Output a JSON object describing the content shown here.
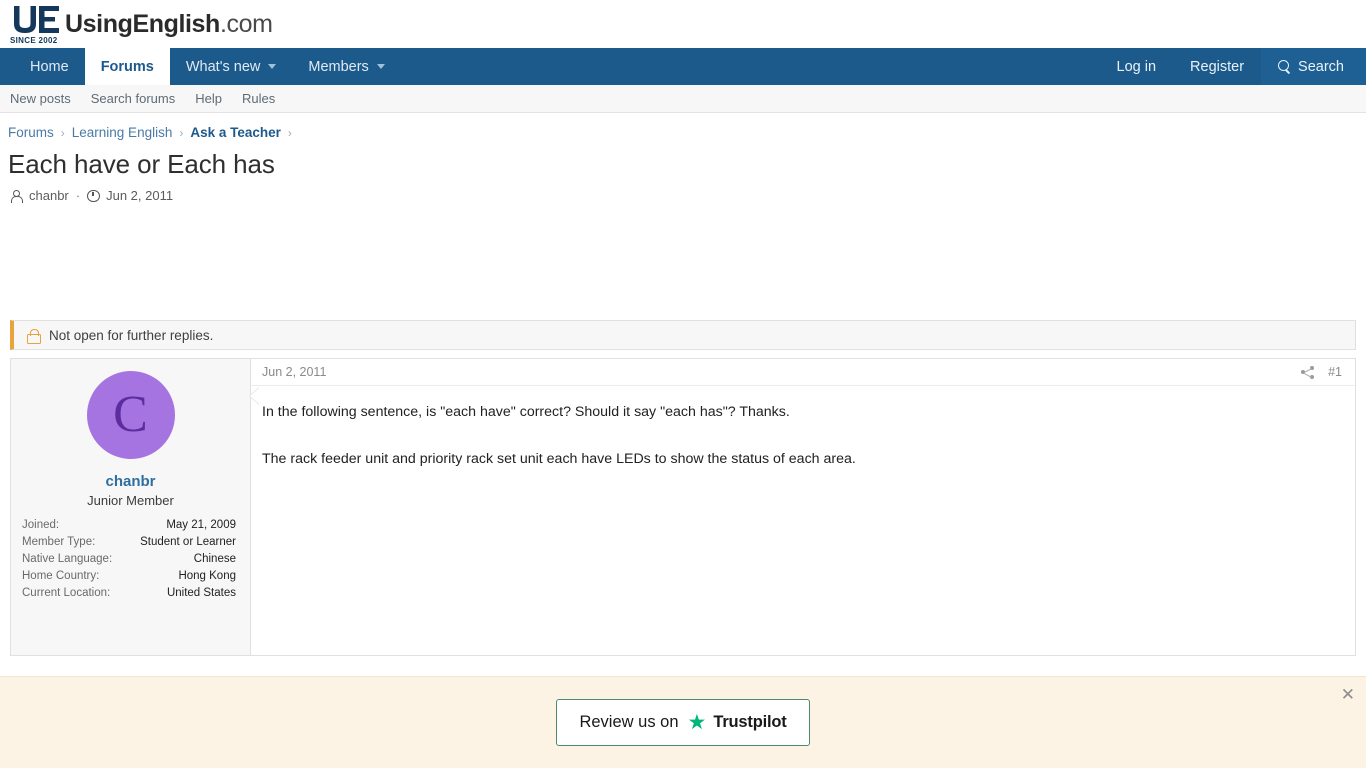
{
  "site": {
    "logo_text_bold": "UsingEnglish",
    "logo_text_light": ".com",
    "logo_since": "SINCE 2002",
    "logo_mark": "ue-monogram"
  },
  "nav": {
    "items": [
      {
        "label": "Home",
        "active": false,
        "caret": false
      },
      {
        "label": "Forums",
        "active": true,
        "caret": false
      },
      {
        "label": "What's new",
        "active": false,
        "caret": true
      },
      {
        "label": "Members",
        "active": false,
        "caret": true
      }
    ],
    "right": [
      {
        "label": "Log in"
      },
      {
        "label": "Register"
      },
      {
        "label": "Search",
        "icon": "search-icon"
      }
    ]
  },
  "subnav": {
    "items": [
      {
        "label": "New posts"
      },
      {
        "label": "Search forums"
      },
      {
        "label": "Help"
      },
      {
        "label": "Rules"
      }
    ]
  },
  "breadcrumb": {
    "separator": "›",
    "items": [
      {
        "label": "Forums",
        "strong": false
      },
      {
        "label": "Learning English",
        "strong": false
      },
      {
        "label": "Ask a Teacher",
        "strong": true
      }
    ]
  },
  "thread": {
    "title": "Each have or Each has",
    "author": "chanbr",
    "separator": "·",
    "date": "Jun 2, 2011"
  },
  "notice": {
    "icon": "lock-icon",
    "text": "Not open for further replies."
  },
  "post": {
    "date": "Jun 2, 2011",
    "share_icon": "share-icon",
    "number": "#1",
    "paragraphs": [
      "In the following sentence, is \"each have\" correct? Should it say \"each has\"? Thanks.",
      "The rack feeder unit and priority rack set unit each have LEDs to show the status of each area."
    ],
    "author": {
      "avatar_letter": "C",
      "avatar_bg": "#a674e0",
      "avatar_fg": "#5b2d9e",
      "username": "chanbr",
      "user_title": "Junior Member",
      "fields": [
        {
          "key": "Joined:",
          "value": "May 21, 2009"
        },
        {
          "key": "Member Type:",
          "value": "Student or Learner"
        },
        {
          "key": "Native Language:",
          "value": "Chinese"
        },
        {
          "key": "Home Country:",
          "value": "Hong Kong"
        },
        {
          "key": "Current Location:",
          "value": "United States"
        }
      ]
    }
  },
  "banner": {
    "button_label": "Review us on",
    "star_glyph": "★",
    "brand": "Trustpilot",
    "brand_color": "#00b67a",
    "close_glyph": "✕"
  }
}
